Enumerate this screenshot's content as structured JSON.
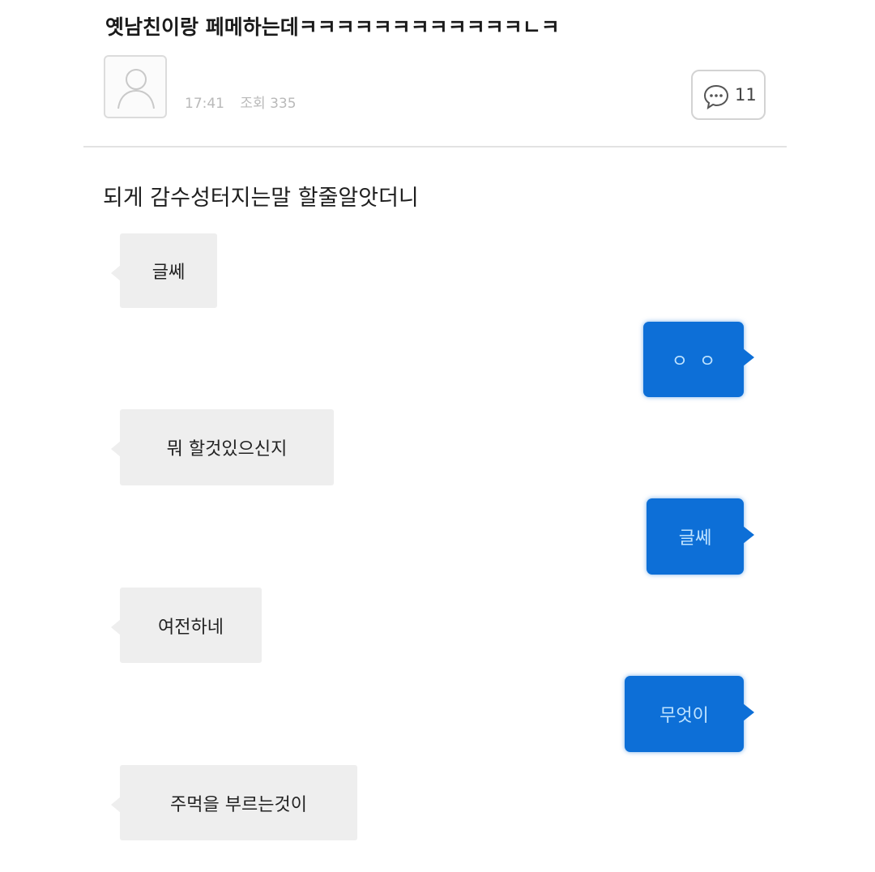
{
  "post": {
    "title": "옛남친이랑 페메하는데ㅋㅋㅋㅋㅋㅋㅋㅋㅋㅋㅋㅋㄴㅋ",
    "time": "17:41",
    "views_label": "조회 335",
    "comment_count": "11"
  },
  "caption": "되게 감수성터지는말 할줄알앗더니",
  "messages": [
    {
      "side": "left",
      "text": "글쎄"
    },
    {
      "side": "right",
      "text": "ㅇㅇ"
    },
    {
      "side": "left",
      "text": "뭐 할것있으신지"
    },
    {
      "side": "right",
      "text": "글쎄"
    },
    {
      "side": "left",
      "text": "여전하네"
    },
    {
      "side": "right",
      "text": "무엇이"
    },
    {
      "side": "left",
      "text": "주먹을 부르는것이"
    }
  ],
  "colors": {
    "sent_bubble": "#0d6fd7",
    "sent_text": "#bfe3ff",
    "received_bubble": "#eeeeee"
  }
}
